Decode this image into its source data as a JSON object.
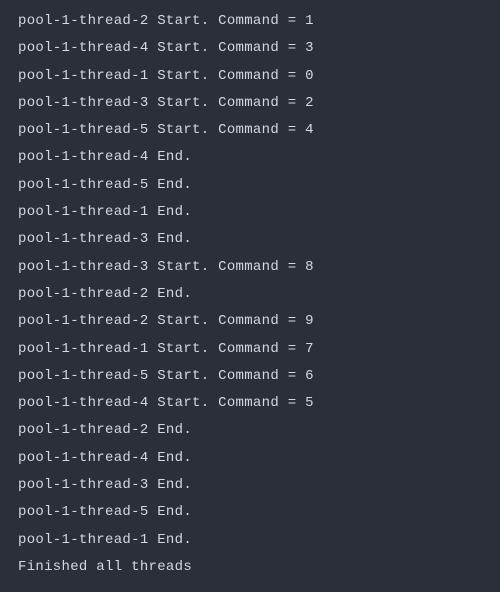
{
  "lines": [
    "pool-1-thread-2 Start. Command = 1",
    "pool-1-thread-4 Start. Command = 3",
    "pool-1-thread-1 Start. Command = 0",
    "pool-1-thread-3 Start. Command = 2",
    "pool-1-thread-5 Start. Command = 4",
    "pool-1-thread-4 End.",
    "pool-1-thread-5 End.",
    "pool-1-thread-1 End.",
    "pool-1-thread-3 End.",
    "pool-1-thread-3 Start. Command = 8",
    "pool-1-thread-2 End.",
    "pool-1-thread-2 Start. Command = 9",
    "pool-1-thread-1 Start. Command = 7",
    "pool-1-thread-5 Start. Command = 6",
    "pool-1-thread-4 Start. Command = 5",
    "pool-1-thread-2 End.",
    "pool-1-thread-4 End.",
    "pool-1-thread-3 End.",
    "pool-1-thread-5 End.",
    "pool-1-thread-1 End.",
    "Finished all threads"
  ]
}
